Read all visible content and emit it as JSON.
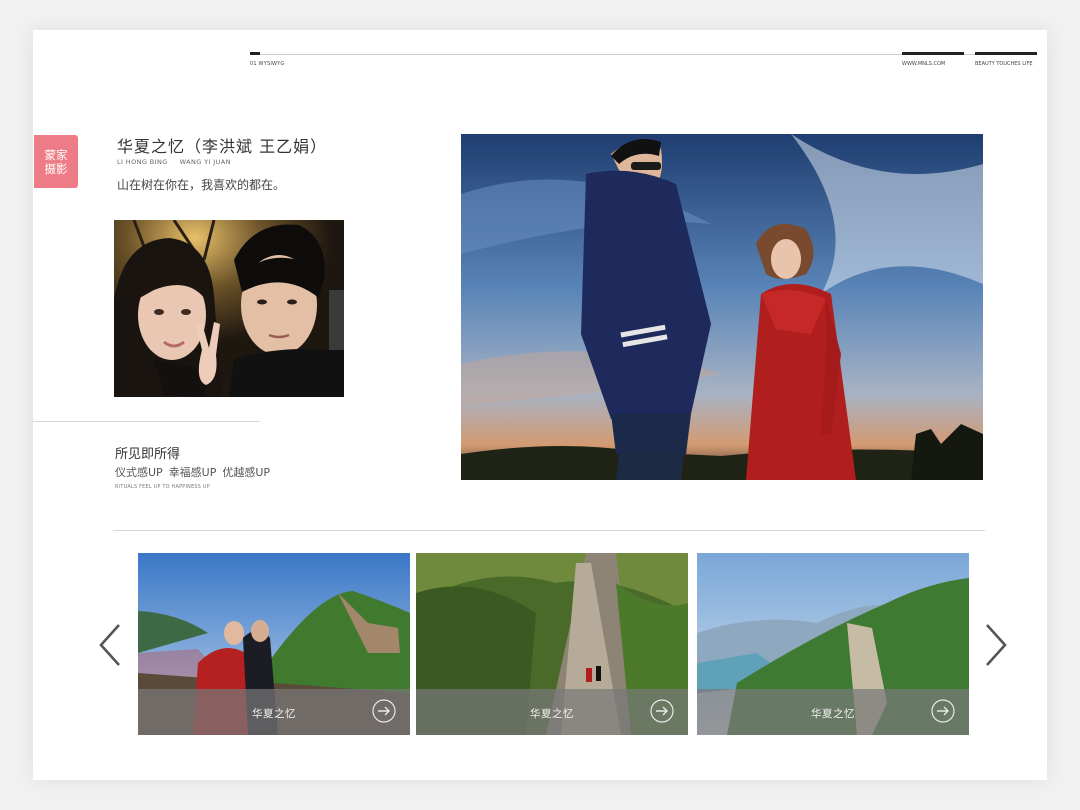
{
  "header": {
    "left_code": "01 WYSIWYG",
    "right_site": "WWW.MNLS.COM",
    "right_slogan": "BEAUTY TOUCHES LIFE"
  },
  "tag": {
    "label": "蒙家摄影"
  },
  "story": {
    "title": "华夏之忆（李洪斌 王乙娟）",
    "groom_en": "LI HONG BING",
    "bride_en": "WANG YI JUAN",
    "quote": "山在树在你在，我喜欢的都在。"
  },
  "feature": {
    "title": "所见即所得",
    "items": [
      "仪式感UP",
      "幸福感UP",
      "优越感UP"
    ],
    "subtitle_en": "RITUALS FEEL UP TO HAPPINESS UP"
  },
  "carousel": {
    "cards": [
      {
        "label": "华夏之忆"
      },
      {
        "label": "华夏之忆"
      },
      {
        "label": "华夏之忆"
      }
    ]
  },
  "colors": {
    "accent_pink": "#ee7c86",
    "text_dark": "#333333",
    "divider": "#d6d6d6"
  },
  "icons": {
    "prev": "chevron-left-icon",
    "next": "chevron-right-icon",
    "go": "arrow-right-circle-icon"
  }
}
